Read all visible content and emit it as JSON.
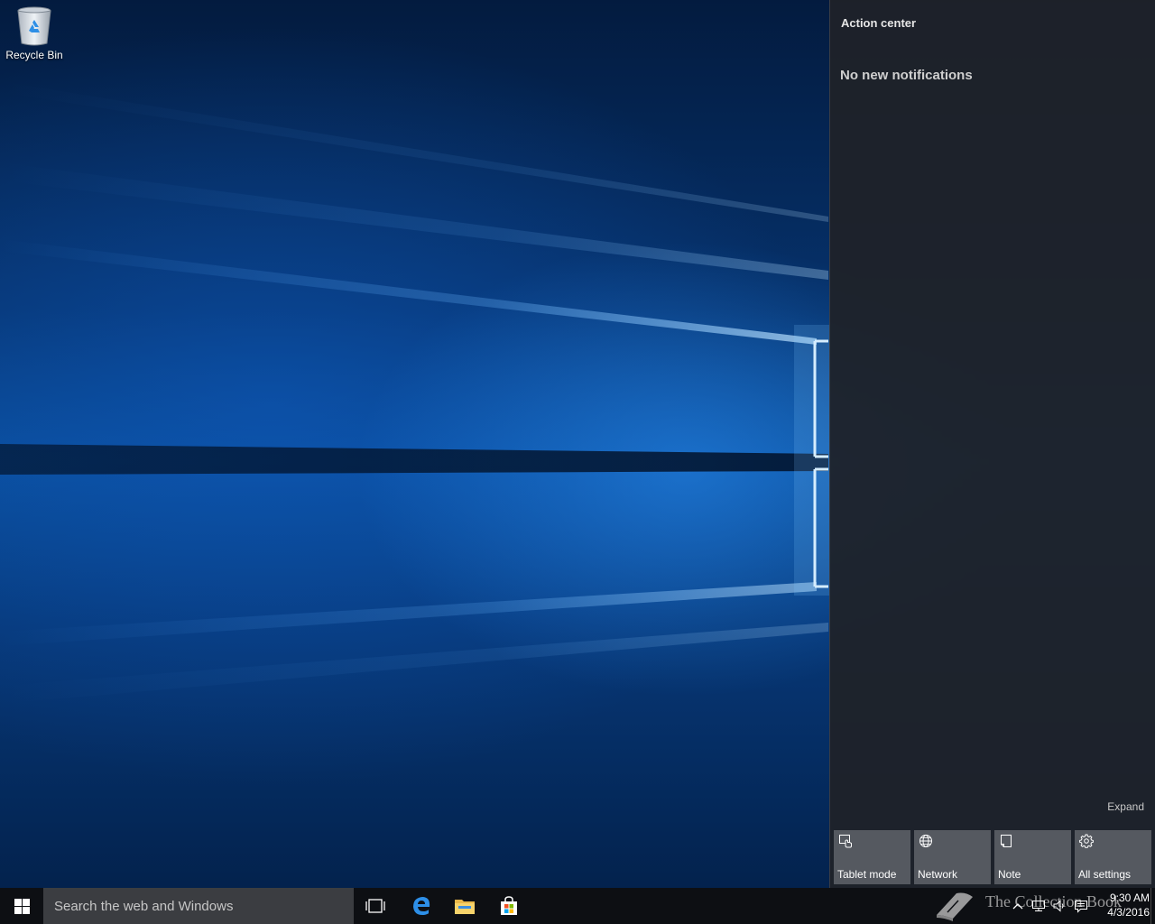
{
  "desktop": {
    "icons": [
      {
        "label": "Recycle Bin",
        "icon": "recycle-bin-icon"
      }
    ]
  },
  "action_center": {
    "title": "Action center",
    "empty_message": "No new notifications",
    "expand_label": "Expand",
    "quick_actions": [
      {
        "label": "Tablet mode",
        "icon": "tablet-mode-icon"
      },
      {
        "label": "Network",
        "icon": "globe-icon"
      },
      {
        "label": "Note",
        "icon": "note-icon"
      },
      {
        "label": "All settings",
        "icon": "gear-icon"
      }
    ]
  },
  "taskbar": {
    "search_placeholder": "Search the web and Windows",
    "pinned_apps": [
      {
        "name": "Task View",
        "icon": "task-view-icon"
      },
      {
        "name": "Microsoft Edge",
        "icon": "edge-icon"
      },
      {
        "name": "File Explorer",
        "icon": "folder-icon"
      },
      {
        "name": "Store",
        "icon": "store-icon"
      }
    ],
    "watermark": "The Collection Book",
    "tray_icons": [
      "chevron-up-icon",
      "network-icon",
      "volume-icon",
      "action-center-icon"
    ],
    "clock": {
      "time": "9:30 AM",
      "date": "4/3/2016"
    }
  },
  "colors": {
    "taskbar_bg": "#0d0f13",
    "action_center_bg": "#1f2228",
    "tile_bg": "#555960",
    "accent": "#0078d7"
  }
}
